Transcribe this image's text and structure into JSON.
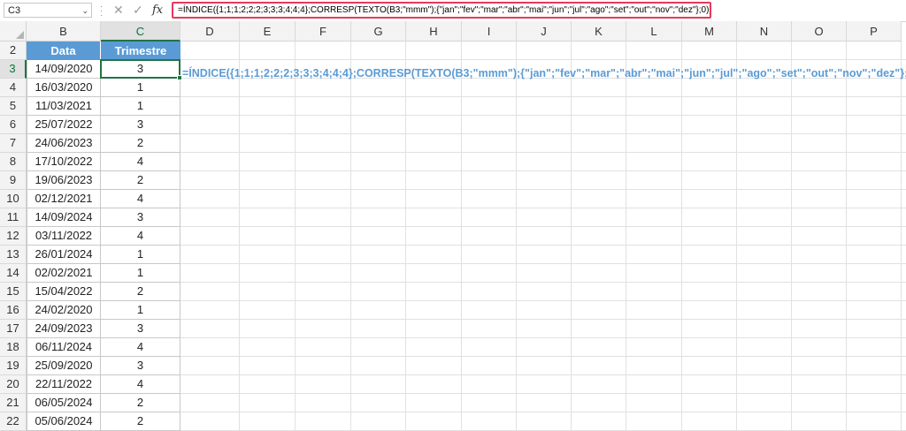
{
  "formula_bar": {
    "name_box": "C3",
    "cancel_icon": "✕",
    "enter_icon": "✓",
    "fx_label": "fx",
    "formula": "=ÍNDICE({1;1;1;2;2;2;3;3;3;4;4;4};CORRESP(TEXTO(B3;\"mmm\");{\"jan\";\"fev\";\"mar\";\"abr\";\"mai\";\"jun\";\"jul\";\"ago\";\"set\";\"out\";\"nov\";\"dez\"};0))"
  },
  "columns": [
    "B",
    "C",
    "D",
    "E",
    "F",
    "G",
    "H",
    "I",
    "J",
    "K",
    "L",
    "M",
    "N",
    "O",
    "P"
  ],
  "rows": [
    "2",
    "3",
    "4",
    "5",
    "6",
    "7",
    "8",
    "9",
    "10",
    "11",
    "12",
    "13",
    "14",
    "15",
    "16",
    "17",
    "18",
    "19",
    "20",
    "21",
    "22"
  ],
  "selected_column": "C",
  "selected_row": "3",
  "table": {
    "header": {
      "data": "Data",
      "trimestre": "Trimestre"
    },
    "records": [
      {
        "data": "14/09/2020",
        "trimestre": "3"
      },
      {
        "data": "16/03/2020",
        "trimestre": "1"
      },
      {
        "data": "11/03/2021",
        "trimestre": "1"
      },
      {
        "data": "25/07/2022",
        "trimestre": "3"
      },
      {
        "data": "24/06/2023",
        "trimestre": "2"
      },
      {
        "data": "17/10/2022",
        "trimestre": "4"
      },
      {
        "data": "19/06/2023",
        "trimestre": "2"
      },
      {
        "data": "02/12/2021",
        "trimestre": "4"
      },
      {
        "data": "14/09/2024",
        "trimestre": "3"
      },
      {
        "data": "03/11/2022",
        "trimestre": "4"
      },
      {
        "data": "26/01/2024",
        "trimestre": "1"
      },
      {
        "data": "02/02/2021",
        "trimestre": "1"
      },
      {
        "data": "15/04/2022",
        "trimestre": "2"
      },
      {
        "data": "24/02/2020",
        "trimestre": "1"
      },
      {
        "data": "24/09/2023",
        "trimestre": "3"
      },
      {
        "data": "06/11/2024",
        "trimestre": "4"
      },
      {
        "data": "25/09/2020",
        "trimestre": "3"
      },
      {
        "data": "22/11/2022",
        "trimestre": "4"
      },
      {
        "data": "06/05/2024",
        "trimestre": "2"
      },
      {
        "data": "05/06/2024",
        "trimestre": "2"
      }
    ]
  },
  "sheet_formula_text": "=ÍNDICE({1;1;1;2;2;2;3;3;3;4;4;4};CORRESP(TEXTO(B3;\"mmm\");{\"jan\";\"fev\";\"mar\";\"abr\";\"mai\";\"jun\";\"jul\";\"ago\";\"set\";\"out\";\"nov\";\"dez\"};0))",
  "colors": {
    "header_fill": "#5b9bd5",
    "selection": "#217346",
    "formula_border": "#e8385a"
  }
}
